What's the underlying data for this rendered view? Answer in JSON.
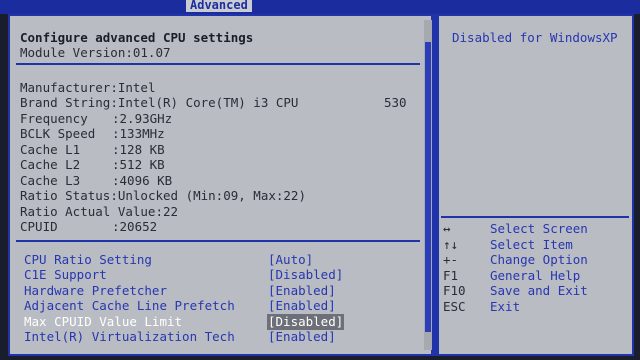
{
  "tab": "Advanced",
  "title": "Configure advanced CPU settings",
  "module_version": "Module Version:01.07",
  "info": [
    {
      "label": "Manufacturer",
      "value": ":Intel"
    },
    {
      "label": "Brand String",
      "value": ":Intel(R) Core(TM) i3 CPU",
      "extra": "530"
    },
    {
      "label": "Frequency",
      "value": ":2.93GHz"
    },
    {
      "label": "BCLK Speed",
      "value": ":133MHz"
    },
    {
      "label": "Cache L1",
      "value": ":128 KB"
    },
    {
      "label": "Cache L2",
      "value": ":512 KB"
    },
    {
      "label": "Cache L3",
      "value": ":4096 KB"
    },
    {
      "label": "Ratio Status",
      "value": ":Unlocked (Min:09, Max:22)"
    },
    {
      "label": "Ratio Actual Value",
      "value": ":22"
    },
    {
      "label": "CPUID",
      "value": ":20652"
    }
  ],
  "options": [
    {
      "label": "CPU Ratio Setting",
      "value": "[Auto]"
    },
    {
      "label": "C1E Support",
      "value": "[Disabled]"
    },
    {
      "label": "Hardware Prefetcher",
      "value": "[Enabled]"
    },
    {
      "label": "Adjacent Cache Line Prefetch",
      "value": "[Enabled]"
    },
    {
      "label": "Max CPUID Value Limit",
      "value": "[Disabled]"
    },
    {
      "label": "Intel(R) Virtualization Tech",
      "value": "[Enabled]"
    }
  ],
  "help_text": "Disabled for WindowsXP",
  "keys": [
    {
      "key": "↔",
      "action": "Select Screen"
    },
    {
      "key": "↑↓",
      "action": "Select Item"
    },
    {
      "key": "+-",
      "action": "Change Option"
    },
    {
      "key": "F1",
      "action": "General Help"
    },
    {
      "key": "F10",
      "action": "Save and Exit"
    },
    {
      "key": "ESC",
      "action": "Exit"
    }
  ]
}
